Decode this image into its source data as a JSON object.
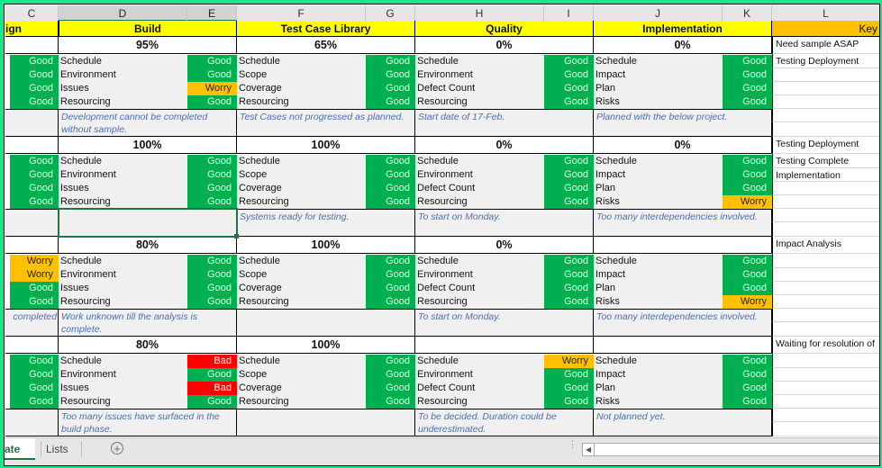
{
  "columns": [
    "C",
    "D",
    "E",
    "F",
    "G",
    "H",
    "I",
    "J",
    "K",
    "L"
  ],
  "selected_columns": [
    "D",
    "E"
  ],
  "headers": {
    "design_partial": "ign",
    "build": "Build",
    "test_case_library": "Test Case Library",
    "quality": "Quality",
    "implementation": "Implementation",
    "key_partial": "Key"
  },
  "blocks": [
    {
      "design_status": [
        "Good",
        "Good",
        "Good",
        "Good"
      ],
      "design_note": "",
      "build": {
        "pct": "95%",
        "labels": [
          "Schedule",
          "Environment",
          "Issues",
          "Resourcing"
        ],
        "status": [
          "Good",
          "Good",
          "Worry",
          "Good"
        ],
        "note": "Development cannot be completed without sample."
      },
      "tcl": {
        "pct": "65%",
        "labels": [
          "Schedule",
          "Scope",
          "Coverage",
          "Resourcing"
        ],
        "status": [
          "Good",
          "Good",
          "Good",
          "Good"
        ],
        "note": "Test Cases not progressed as planned."
      },
      "quality": {
        "pct": "0%",
        "labels": [
          "Schedule",
          "Environment",
          "Defect Count",
          "Resourcing"
        ],
        "status": [
          "Good",
          "Good",
          "Good",
          "Good"
        ],
        "note": "Start date of 17-Feb."
      },
      "impl": {
        "pct": "0%",
        "labels": [
          "Schedule",
          "Impact",
          "Plan",
          "Risks"
        ],
        "status": [
          "Good",
          "Good",
          "Good",
          "Good"
        ],
        "note": "Planned with the below project."
      },
      "key": [
        "Need sample ASAP",
        "Testing Deployment",
        "",
        "",
        "",
        "",
        ""
      ]
    },
    {
      "design_status": [
        "Good",
        "Good",
        "Good",
        "Good"
      ],
      "design_note": "",
      "build": {
        "pct": "100%",
        "labels": [
          "Schedule",
          "Environment",
          "Issues",
          "Resourcing"
        ],
        "status": [
          "Good",
          "Good",
          "Good",
          "Good"
        ],
        "note": ""
      },
      "tcl": {
        "pct": "100%",
        "labels": [
          "Schedule",
          "Scope",
          "Coverage",
          "Resourcing"
        ],
        "status": [
          "Good",
          "Good",
          "Good",
          "Good"
        ],
        "note": "Systems ready for testing."
      },
      "quality": {
        "pct": "0%",
        "labels": [
          "Schedule",
          "Environment",
          "Defect Count",
          "Resourcing"
        ],
        "status": [
          "Good",
          "Good",
          "Good",
          "Good"
        ],
        "note": "To start on Monday."
      },
      "impl": {
        "pct": "0%",
        "labels": [
          "Schedule",
          "Impact",
          "Plan",
          "Risks"
        ],
        "status": [
          "Good",
          "Good",
          "Good",
          "Worry"
        ],
        "note": "Too many interdependencies involved."
      },
      "key": [
        "Testing Deployment",
        "Testing Complete",
        "Implementation",
        "",
        "",
        "",
        ""
      ]
    },
    {
      "design_status": [
        "Worry",
        "Worry",
        "Good",
        "Good"
      ],
      "design_note": "completed",
      "build": {
        "pct": "80%",
        "labels": [
          "Schedule",
          "Environment",
          "Issues",
          "Resourcing"
        ],
        "status": [
          "Good",
          "Good",
          "Good",
          "Good"
        ],
        "note": "Work unknown till the analysis is complete."
      },
      "tcl": {
        "pct": "100%",
        "labels": [
          "Schedule",
          "Scope",
          "Coverage",
          "Resourcing"
        ],
        "status": [
          "Good",
          "Good",
          "Good",
          "Good"
        ],
        "note": ""
      },
      "quality": {
        "pct": "0%",
        "labels": [
          "Schedule",
          "Environment",
          "Defect Count",
          "Resourcing"
        ],
        "status": [
          "Good",
          "Good",
          "Good",
          "Good"
        ],
        "note": "To start on Monday."
      },
      "impl": {
        "pct": "",
        "labels": [
          "Schedule",
          "Impact",
          "Plan",
          "Risks"
        ],
        "status": [
          "Good",
          "Good",
          "Good",
          "Worry"
        ],
        "note": "Too many interdependencies involved."
      },
      "key": [
        "Impact Analysis",
        "",
        "",
        "",
        "",
        "",
        ""
      ]
    },
    {
      "design_status": [
        "Good",
        "Good",
        "Good",
        "Good"
      ],
      "design_note": "",
      "build": {
        "pct": "80%",
        "labels": [
          "Schedule",
          "Environment",
          "Issues",
          "Resourcing"
        ],
        "status": [
          "Bad",
          "Good",
          "Bad",
          "Good"
        ],
        "note": "Too many issues have surfaced in the build phase."
      },
      "tcl": {
        "pct": "100%",
        "labels": [
          "Schedule",
          "Scope",
          "Coverage",
          "Resourcing"
        ],
        "status": [
          "Good",
          "Good",
          "Good",
          "Good"
        ],
        "note": ""
      },
      "quality": {
        "pct": "",
        "labels": [
          "Schedule",
          "Environment",
          "Defect Count",
          "Resourcing"
        ],
        "status": [
          "Worry",
          "Good",
          "Good",
          "Good"
        ],
        "note": "To be decided. Duration could be underestimated."
      },
      "impl": {
        "pct": "",
        "labels": [
          "Schedule",
          "Impact",
          "Plan",
          "Risks"
        ],
        "status": [
          "Good",
          "Good",
          "Good",
          "Good"
        ],
        "note": "Not planned yet."
      },
      "key": [
        "Waiting for resolution of",
        "",
        "",
        "",
        "",
        "",
        ""
      ]
    }
  ],
  "sheet_tabs": {
    "active_partial": "ate",
    "other": "Lists",
    "add_icon": "plus-circle-icon",
    "options_icon": "vertical-dots-icon",
    "scroll_left_icon": "triangle-left-icon"
  },
  "status_colors": {
    "Good": "#00b050",
    "Worry": "#ffc000",
    "Bad": "#ff0000"
  }
}
